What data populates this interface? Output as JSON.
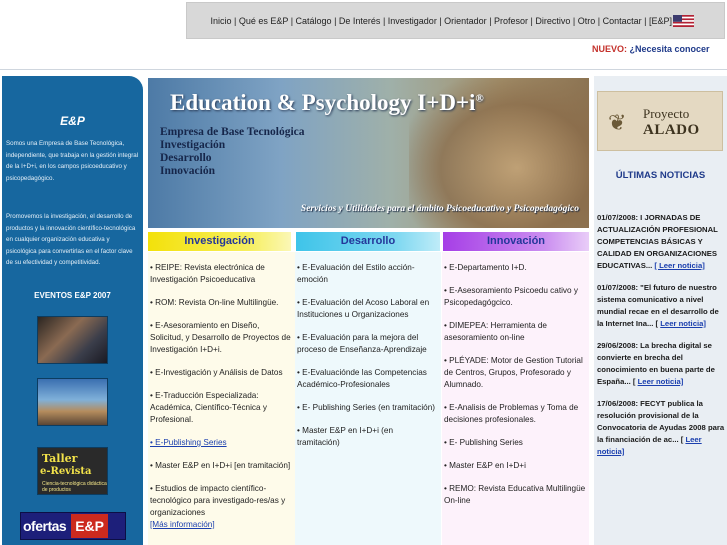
{
  "nav": {
    "links": [
      "Inicio",
      "Qué es E&P",
      "Catálogo",
      "De Interés",
      "Investigador",
      "Orientador",
      "Profesor",
      "Directivo",
      "Otro",
      "Contactar",
      "[E&P]"
    ],
    "flag_icon": "us-flag-icon"
  },
  "nuevo": {
    "label": "NUEVO:",
    "text": "¿Necesita conocer"
  },
  "sidebar": {
    "brand": "E&P",
    "p1": "Somos una Empresa de Base Tecnológica, independiente, que trabaja en la gestión integral de la I+D+i, en los campos psicoeducativo y psicopedagógico.",
    "p2": "Promovemos la investigación, el desarrollo de productos y la innovación científico-tecnológica en cualquier organización educativa y psicológica para convertirlas en el factor clave de su efectividad y competitividad.",
    "events_title": "EVENTOS E&P 2007",
    "thumb3": {
      "line1": "Taller",
      "line2": "e-Revista",
      "line3": "Ciencia-tecnológica didáctica de productos"
    },
    "ofertas": {
      "word": "ofertas",
      "brand": "E&P"
    }
  },
  "banner": {
    "title": "Education & Psychology I+D+i",
    "registered": "®",
    "sub": [
      "Empresa de Base Tecnológica",
      "Investigación",
      "Desarrollo",
      "Innovación"
    ],
    "tagline": "Servicios y Utilidades para el ámbito Psicoeducativo y Psicopedagógico"
  },
  "columns": {
    "investigacion": {
      "title": "Investigación",
      "items": [
        "• REIPE: Revista electrónica de Investigación Psicoeducativa",
        "• ROM: Revista On-line Multilingüe.",
        "• E-Asesoramiento en Diseño, Solicitud, y Desarrollo de Proyectos de Investigación I+D+i.",
        "• E-Investigación y Análisis de Datos",
        "• E-Traducción Especializada: Académica, Científico-Técnica y Profesional.",
        "• E-Publishing Series",
        "• Master E&P en I+D+i [en tramitación]",
        "• Estudios de impacto científico-tecnológico para investigado-res/as y organizaciones",
        "[Más información]"
      ]
    },
    "desarrollo": {
      "title": "Desarrollo",
      "items": [
        "• E-Evaluación del Estilo acción-emoción",
        "• E-Evaluación del Acoso Laboral en Instituciones u Organizaciones",
        "• E-Evaluación para la mejora del proceso de Enseñanza-Aprendizaje",
        "• E-Evaluaciónde las Competencias Académico-Profesionales",
        "• E- Publishing Series (en tramitación)",
        "• Master E&P en I+D+i (en tramitación)"
      ]
    },
    "innovacion": {
      "title": "Innovación",
      "items": [
        "• E-Departamento I+D.",
        "• E-Asesoramiento Psicoedu cativo y Psicopedagógcico.",
        "• DIMEPEA: Herramienta de asesoramiento on-line",
        "• PLÉYADE: Motor de Gestion Tutorial de Centros, Grupos, Profesorado y Alumnado.",
        "• E-Analisis de Problemas y Toma de decisiones profesionales.",
        "• E- Publishing Series",
        "• Master E&P en I+D+i",
        "• REMO: Revista Educativa Multilingüe On-line"
      ]
    }
  },
  "right": {
    "alado": {
      "l1": "Proyecto",
      "l2": "ALADO"
    },
    "title": "ÚLTIMAS NOTICIAS",
    "news": [
      {
        "text": "01/07/2008: I JORNADAS DE ACTUALIZACIÓN PROFESIONAL COMPETENCIAS BÁSICAS Y CALIDAD EN ORGANIZACIONES EDUCATIVAS... ",
        "more": "[ Leer noticia]"
      },
      {
        "text": "01/07/2008: \"El futuro de nuestro sistema comunicativo a nivel mundial recae en el desarrollo de la Internet Ina... [ ",
        "more": "Leer noticia]"
      },
      {
        "text": "29/06/2008: La brecha digital se convierte en brecha del conocimiento en buena parte de España... [ ",
        "more": "Leer noticia]"
      },
      {
        "text": "17/06/2008: FECYT publica la resolución provisional de la Convocatoria de Ayudas 2008 para la financiación de ac... [ ",
        "more": "Leer noticia]"
      }
    ]
  }
}
